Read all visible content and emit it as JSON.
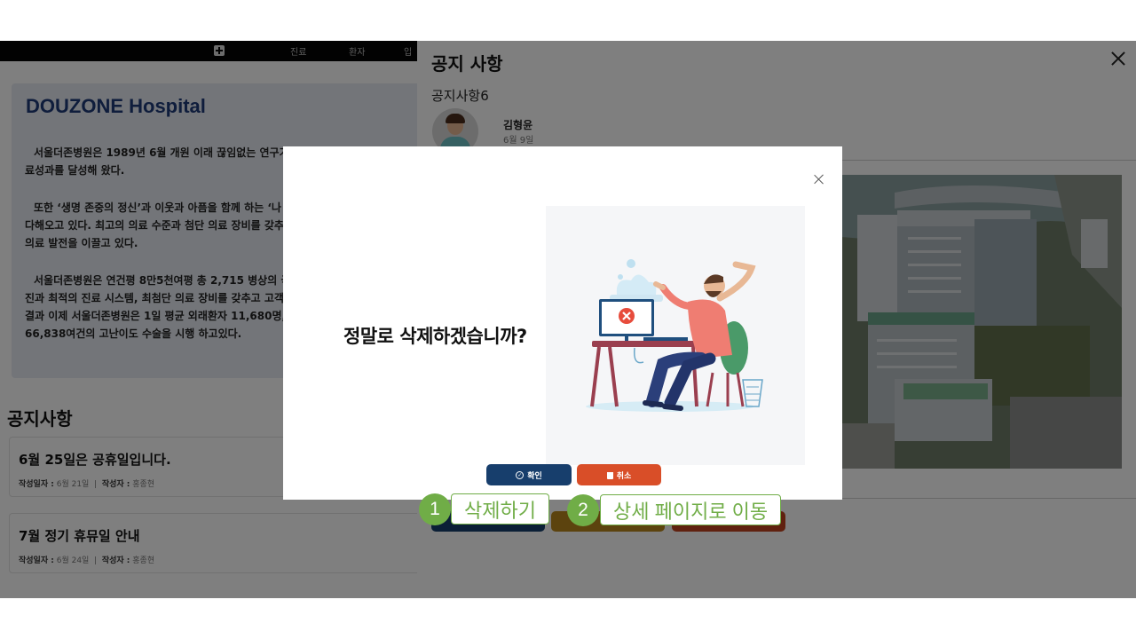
{
  "nav": {
    "links": [
      "진료",
      "환자",
      "입"
    ]
  },
  "intro": {
    "title": "DOUZONE Hospital",
    "paragraphs": [
      "서울더존병원은 1989년 6월 개원 이래 끊임없는 연구가\n료성과를 달성해 왔다.",
      "또한 ‘생명 존중의 정신’과 이웃과 아픔을 함께 하는 ‘나\n다해오고 있다. 최고의 의료 수준과 첨단 의료 장비를 갖추\n의료 발전을 이끌고 있다.",
      "서울더존병원은 연건평 8만5천여평 총 2,715 병상의 국\n진과 최적의 진료 시스템, 최첨단 의료 장비를 갖추고 고객\n결과 이제 서울더존병원은 1일 평균 외래환자 11,680명,\n66,838여건의 고난이도 수술을 시행 하고있다."
    ]
  },
  "notices": {
    "heading": "공지사항",
    "items": [
      {
        "title": "6월 25일은 공휴일입니다.",
        "date_label": "작성일자 :",
        "date": "6월 21일",
        "author_label": "작성자 :",
        "author": "홍종현"
      },
      {
        "title": "7월 정기 휴뮤일 안내",
        "date_label": "작성일자 :",
        "date": "6월 24일",
        "author_label": "작성자 :",
        "author": "홍종현"
      }
    ]
  },
  "drawer": {
    "title": "공지 사항",
    "notice_title": "공지사항6",
    "author_name": "김형윤",
    "author_date": "6월 9일",
    "action_colors": [
      "#173e6c",
      "#b8871c",
      "#c0431f"
    ]
  },
  "modal": {
    "question": "정말로 삭제하겠습니까?",
    "confirm_label": "확인",
    "cancel_label": "취소",
    "confirm_icon": "check-circle-icon",
    "cancel_icon": "trash-icon"
  },
  "callouts": [
    {
      "number": "1",
      "label": "삭제하기"
    },
    {
      "number": "2",
      "label": "상세 페이지로 이동"
    }
  ],
  "colors": {
    "accent_green": "#70ad47",
    "confirm_blue": "#173e6c",
    "cancel_orange": "#d94e28",
    "brand_navy": "#1f3a78"
  }
}
